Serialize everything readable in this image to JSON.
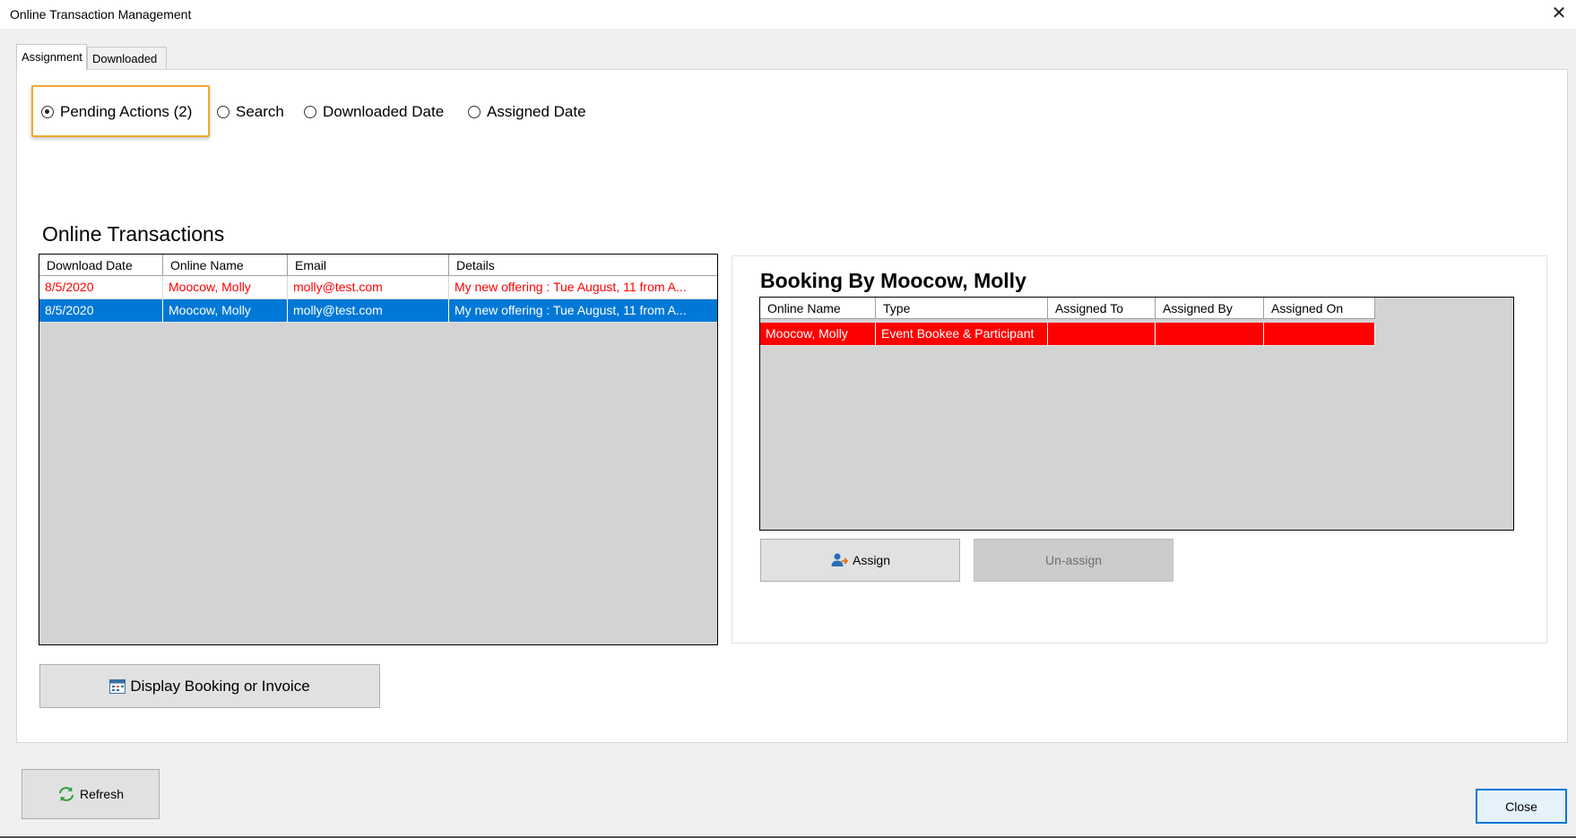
{
  "window": {
    "title": "Online Transaction Management",
    "close_symbol": "✕"
  },
  "tabs": [
    {
      "label": "Assignment",
      "active": true
    },
    {
      "label": "Downloaded",
      "active": false
    }
  ],
  "filter_options": [
    {
      "label": "Pending Actions (2)",
      "checked": true
    },
    {
      "label": "Search",
      "checked": false
    },
    {
      "label": "Downloaded Date",
      "checked": false
    },
    {
      "label": "Assigned Date",
      "checked": false
    }
  ],
  "transactions": {
    "title": "Online Transactions",
    "columns": [
      "Download Date",
      "Online Name",
      "Email",
      "Details"
    ],
    "rows": [
      {
        "download_date": "8/5/2020",
        "online_name": "Moocow, Molly",
        "email": "molly@test.com",
        "details": "My new offering : Tue August, 11 from A...",
        "state": "pending"
      },
      {
        "download_date": "8/5/2020",
        "online_name": "Moocow, Molly",
        "email": "molly@test.com",
        "details": "My new offering : Tue August, 11 from A...",
        "state": "selected"
      }
    ]
  },
  "booking": {
    "title": "Booking By Moocow, Molly",
    "columns": [
      "Online Name",
      "Type",
      "Assigned To",
      "Assigned By",
      "Assigned On"
    ],
    "rows": [
      {
        "online_name": "Moocow, Molly",
        "type": "Event Bookee & Participant",
        "assigned_to": "",
        "assigned_by": "",
        "assigned_on": ""
      }
    ],
    "assign_label": "Assign",
    "unassign_label": "Un-assign"
  },
  "display_booking_label": "Display Booking or Invoice",
  "refresh_label": "Refresh",
  "close_label": "Close",
  "colors": {
    "pending_text": "#ff0000",
    "selected_row": "#0078d7",
    "unassigned_row": "#ff0000",
    "highlight_border": "#f0a830"
  },
  "icons": {
    "assign": "user-assign-icon",
    "display": "calendar-grid-icon",
    "refresh": "refresh-arrows-icon"
  }
}
